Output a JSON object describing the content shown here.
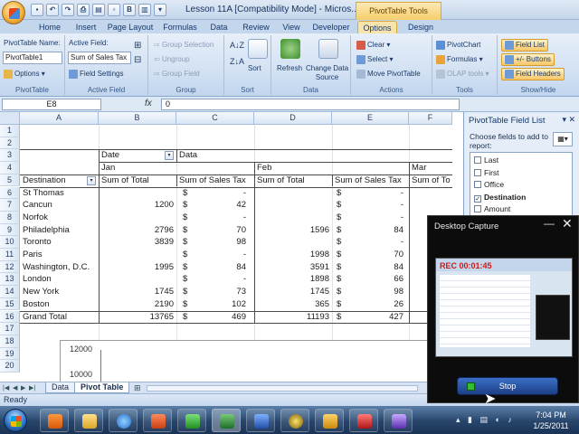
{
  "window": {
    "title": "Lesson 11A  [Compatibility Mode] - Micros...",
    "contextual_tab_group": "PivotTable Tools"
  },
  "ribbon_tabs": [
    "Home",
    "Insert",
    "Page Layout",
    "Formulas",
    "Data",
    "Review",
    "View",
    "Developer",
    "Options",
    "Design"
  ],
  "ribbon": {
    "pivottable": {
      "name_label": "PivotTable Name:",
      "name_value": "PivotTable1",
      "options_label": "Options",
      "group_label": "PivotTable"
    },
    "active_field": {
      "label": "Active Field:",
      "value": "Sum of Sales Tax",
      "settings_label": "Field Settings",
      "group_label": "Active Field"
    },
    "group": {
      "selection_label": "Group Selection",
      "ungroup_label": "Ungroup",
      "group_field_label": "Group Field",
      "group_label": "Group"
    },
    "sort": {
      "sort_label": "Sort",
      "group_label": "Sort"
    },
    "data": {
      "refresh_label": "Refresh",
      "change_source_label": "Change Data\nSource",
      "group_label": "Data"
    },
    "actions": {
      "clear_label": "Clear",
      "select_label": "Select",
      "move_label": "Move PivotTable",
      "group_label": "Actions"
    },
    "tools": {
      "pivotchart_label": "PivotChart",
      "formulas_label": "Formulas",
      "olap_label": "OLAP tools",
      "group_label": "Tools"
    },
    "showhide": {
      "field_list_label": "Field List",
      "buttons_label": "+/- Buttons",
      "headers_label": "Field Headers",
      "group_label": "Show/Hide"
    }
  },
  "formula_bar": {
    "name_box": "E8",
    "fx": "fx",
    "value": "0"
  },
  "grid": {
    "columns": [
      "A",
      "B",
      "C",
      "D",
      "E",
      "F"
    ],
    "rows": [
      "1",
      "2",
      "3",
      "4",
      "5",
      "6",
      "7",
      "8",
      "9",
      "10",
      "11",
      "12",
      "13",
      "14",
      "15",
      "16",
      "17",
      "18",
      "19",
      "20"
    ],
    "pivot": {
      "r3": {
        "date": "Date",
        "data": "Data"
      },
      "r4": {
        "jan": "Jan",
        "feb": "Feb",
        "mar": "Mar"
      },
      "r5": {
        "destination": "Destination",
        "sum_total": "Sum of Total",
        "sum_tax": "Sum of Sales Tax",
        "sum_total_feb": "Sum of Total",
        "sum_tax_feb": "Sum of Sales Tax",
        "sum_total_mar": "Sum of To"
      },
      "body": [
        {
          "dest": "St Thomas",
          "jan_total": "",
          "jan_tax_sym": "$",
          "jan_tax": "-",
          "feb_total": "",
          "feb_tax_sym": "$",
          "feb_tax": "-"
        },
        {
          "dest": "Cancun",
          "jan_total": "1200",
          "jan_tax_sym": "$",
          "jan_tax": "42",
          "feb_total": "",
          "feb_tax_sym": "$",
          "feb_tax": "-"
        },
        {
          "dest": "Norfok",
          "jan_total": "",
          "jan_tax_sym": "$",
          "jan_tax": "-",
          "feb_total": "",
          "feb_tax_sym": "$",
          "feb_tax": "-"
        },
        {
          "dest": "Philadelphia",
          "jan_total": "2796",
          "jan_tax_sym": "$",
          "jan_tax": "70",
          "feb_total": "1596",
          "feb_tax_sym": "$",
          "feb_tax": "84"
        },
        {
          "dest": "Toronto",
          "jan_total": "3839",
          "jan_tax_sym": "$",
          "jan_tax": "98",
          "feb_total": "",
          "feb_tax_sym": "$",
          "feb_tax": "-"
        },
        {
          "dest": "Paris",
          "jan_total": "",
          "jan_tax_sym": "$",
          "jan_tax": "-",
          "feb_total": "1998",
          "feb_tax_sym": "$",
          "feb_tax": "70"
        },
        {
          "dest": "Washington, D.C.",
          "jan_total": "1995",
          "jan_tax_sym": "$",
          "jan_tax": "84",
          "feb_total": "3591",
          "feb_tax_sym": "$",
          "feb_tax": "84"
        },
        {
          "dest": "London",
          "jan_total": "",
          "jan_tax_sym": "$",
          "jan_tax": "-",
          "feb_total": "1898",
          "feb_tax_sym": "$",
          "feb_tax": "66"
        },
        {
          "dest": "New York",
          "jan_total": "1745",
          "jan_tax_sym": "$",
          "jan_tax": "73",
          "feb_total": "1745",
          "feb_tax_sym": "$",
          "feb_tax": "98"
        },
        {
          "dest": "Boston",
          "jan_total": "2190",
          "jan_tax_sym": "$",
          "jan_tax": "102",
          "feb_total": "365",
          "feb_tax_sym": "$",
          "feb_tax": "26"
        }
      ],
      "grand": {
        "label": "Grand Total",
        "jan_total": "13765",
        "jan_tax_sym": "$",
        "jan_tax": "469",
        "feb_total": "11193",
        "feb_tax_sym": "$",
        "feb_tax": "427"
      }
    },
    "chart_ticks": [
      "12000",
      "10000"
    ]
  },
  "sheet_tabs": [
    "Data",
    "Pivot Table"
  ],
  "status": "Ready",
  "field_list": {
    "title": "PivotTable Field List",
    "subtitle": "Choose fields to add to report:",
    "fields": [
      {
        "label": "Last",
        "checked": false
      },
      {
        "label": "First",
        "checked": false
      },
      {
        "label": "Office",
        "checked": false
      },
      {
        "label": "Destination",
        "checked": true
      },
      {
        "label": "Amount",
        "checked": false
      }
    ]
  },
  "capture": {
    "title": "Desktop Capture",
    "rec": "REC 00:01:45",
    "stop_label": "Stop"
  },
  "taskbar": {
    "time": "7:04 PM",
    "date": "1/25/2011"
  },
  "colors": {
    "ribbon_active": "#f6e3ad",
    "rec_red": "#d01818",
    "stop_green": "#2fc02f"
  }
}
